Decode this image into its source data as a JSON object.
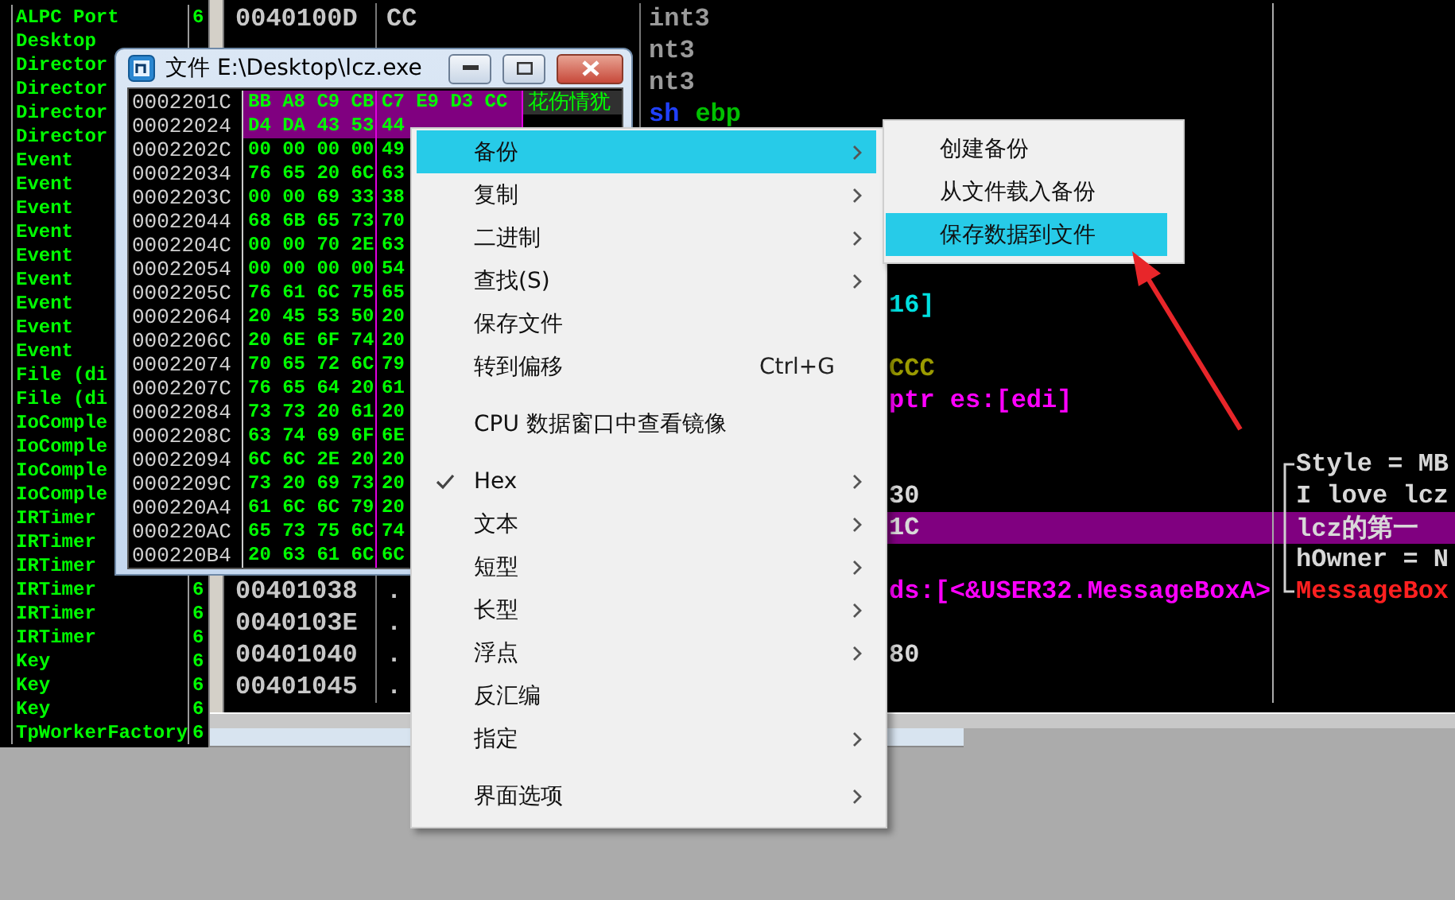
{
  "handles": {
    "rows": [
      {
        "type": "ALPC Port",
        "count": "6"
      },
      {
        "type": "Desktop"
      },
      {
        "type": "Director"
      },
      {
        "type": "Director"
      },
      {
        "type": "Director"
      },
      {
        "type": "Director"
      },
      {
        "type": "Event"
      },
      {
        "type": "Event"
      },
      {
        "type": "Event"
      },
      {
        "type": "Event"
      },
      {
        "type": "Event"
      },
      {
        "type": "Event"
      },
      {
        "type": "Event"
      },
      {
        "type": "Event"
      },
      {
        "type": "Event"
      },
      {
        "type": "File (di"
      },
      {
        "type": "File (di"
      },
      {
        "type": "IoComple"
      },
      {
        "type": "IoComple"
      },
      {
        "type": "IoComple"
      },
      {
        "type": "IoComple"
      },
      {
        "type": "IRTimer"
      },
      {
        "type": "IRTimer"
      },
      {
        "type": "IRTimer"
      },
      {
        "type": "IRTimer",
        "count": "6"
      },
      {
        "type": "IRTimer",
        "count": "6"
      },
      {
        "type": "IRTimer",
        "count": "6"
      },
      {
        "type": "Key",
        "count": "6"
      },
      {
        "type": "Key",
        "count": "6"
      },
      {
        "type": "Key",
        "count": "6"
      },
      {
        "type": "TpWorkerFactory",
        "count": "6"
      }
    ]
  },
  "disassembly": {
    "rows": [
      {
        "selected": false,
        "address": "0040100D",
        "bytes": "CC",
        "instruction": [
          {
            "text": "int3",
            "kind": "filler"
          }
        ]
      },
      {
        "selected": false,
        "instruction": [
          {
            "text": "nt3",
            "kind": "filler"
          }
        ]
      },
      {
        "selected": false,
        "instruction": [
          {
            "text": "nt3",
            "kind": "filler"
          }
        ]
      },
      {
        "selected": false,
        "instruction": [
          {
            "text": "sh",
            "kind": "keyword"
          },
          {
            "text": "ebp",
            "kind": "register"
          }
        ]
      },
      {
        "selected": false
      },
      {
        "selected": false
      },
      {
        "selected": false
      },
      {
        "selected": false
      },
      {
        "selected": false
      },
      {
        "selected": false,
        "instruction_tail": {
          "text": "16]",
          "kind": "memory"
        }
      },
      {
        "selected": false
      },
      {
        "selected": false,
        "instruction_tail": {
          "text": "CCC",
          "kind": "constant"
        }
      },
      {
        "selected": false,
        "instruction_tail": {
          "text": "ptr es:[edi]",
          "kind": "string"
        }
      },
      {
        "selected": false
      },
      {
        "selected": false,
        "comment": {
          "text": "Style = MB",
          "kind": "plain"
        }
      },
      {
        "selected": false,
        "instruction_tail": {
          "text": "30",
          "kind": "plain"
        },
        "comment": {
          "text": "I love lcz",
          "kind": "plain"
        }
      },
      {
        "selected": true,
        "instruction_tail": {
          "text": "1C",
          "kind": "plain"
        },
        "comment": {
          "text": "lcz的第一",
          "kind": "plain"
        }
      },
      {
        "selected": false,
        "comment": {
          "text": "hOwner = N",
          "kind": "plain"
        }
      },
      {
        "selected": false,
        "address": "00401038",
        "bytes": ".",
        "instruction_tail": {
          "text": "ds:[<&USER32.MessageBoxA>",
          "kind": "string"
        },
        "comment": {
          "text": "MessageBox",
          "kind": "call"
        }
      },
      {
        "selected": false,
        "address": "0040103E",
        "bytes": "."
      },
      {
        "selected": false,
        "address": "00401040",
        "bytes": ".",
        "instruction_tail": {
          "text": "80",
          "kind": "plain"
        }
      },
      {
        "selected": false,
        "address": "00401045",
        "bytes": "."
      }
    ]
  },
  "hex_window": {
    "title": "文件 E:\\Desktop\\lcz.exe",
    "rows": [
      {
        "address": "0002201C",
        "group_1": "BB A8 C9 CB",
        "group_2": "C7 E9 D3 CC",
        "ascii": "花伤情犹",
        "selected": true
      },
      {
        "address": "00022024",
        "group_1": "D4 DA 43 53",
        "group_2": "44",
        "selected": true
      },
      {
        "address": "0002202C",
        "group_1": "00 00 00 00",
        "group_2": "49",
        "selected": false
      },
      {
        "address": "00022034",
        "group_1": "76 65 20 6C",
        "group_2": "63",
        "selected": false
      },
      {
        "address": "0002203C",
        "group_1": "00 00 69 33",
        "group_2": "38",
        "selected": false
      },
      {
        "address": "00022044",
        "group_1": "68 6B 65 73",
        "group_2": "70",
        "selected": false
      },
      {
        "address": "0002204C",
        "group_1": "00 00 70 2E",
        "group_2": "63",
        "selected": false
      },
      {
        "address": "00022054",
        "group_1": "00 00 00 00",
        "group_2": "54",
        "selected": false
      },
      {
        "address": "0002205C",
        "group_1": "76 61 6C 75",
        "group_2": "65",
        "selected": false
      },
      {
        "address": "00022064",
        "group_1": "20 45 53 50",
        "group_2": "20",
        "selected": false
      },
      {
        "address": "0002206C",
        "group_1": "20 6E 6F 74",
        "group_2": "20",
        "selected": false
      },
      {
        "address": "00022074",
        "group_1": "70 65 72 6C",
        "group_2": "79",
        "selected": false
      },
      {
        "address": "0002207C",
        "group_1": "76 65 64 20",
        "group_2": "61",
        "selected": false
      },
      {
        "address": "00022084",
        "group_1": "73 73 20 61",
        "group_2": "20",
        "selected": false
      },
      {
        "address": "0002208C",
        "group_1": "63 74 69 6F",
        "group_2": "6E",
        "selected": false
      },
      {
        "address": "00022094",
        "group_1": "6C 6C 2E 20",
        "group_2": "20",
        "selected": false
      },
      {
        "address": "0002209C",
        "group_1": "73 20 69 73",
        "group_2": "20",
        "selected": false
      },
      {
        "address": "000220A4",
        "group_1": "61 6C 6C 79",
        "group_2": "20",
        "selected": false
      },
      {
        "address": "000220AC",
        "group_1": "65 73 75 6C",
        "group_2": "74",
        "selected": false
      },
      {
        "address": "000220B4",
        "group_1": "20 63 61 6C",
        "group_2": "6C",
        "selected": false
      }
    ]
  },
  "context_menu": {
    "groups": [
      [
        {
          "label": "备份",
          "submenu": true,
          "selected": true,
          "checked": false
        },
        {
          "label": "复制",
          "submenu": true,
          "selected": false,
          "checked": false
        },
        {
          "label": "二进制",
          "submenu": true,
          "selected": false,
          "checked": false
        },
        {
          "label": "查找(S)",
          "submenu": true,
          "selected": false,
          "checked": false
        },
        {
          "label": "保存文件",
          "submenu": false,
          "selected": false,
          "checked": false
        },
        {
          "label": "转到偏移",
          "shortcut": "Ctrl+G",
          "submenu": false,
          "selected": false,
          "checked": false
        }
      ],
      [
        {
          "label": "CPU 数据窗口中查看镜像",
          "submenu": false,
          "selected": false,
          "checked": false
        }
      ],
      [
        {
          "label": "Hex",
          "submenu": true,
          "selected": false,
          "checked": true
        },
        {
          "label": "文本",
          "submenu": true,
          "selected": false,
          "checked": false
        },
        {
          "label": "短型",
          "submenu": true,
          "selected": false,
          "checked": false
        },
        {
          "label": "长型",
          "submenu": true,
          "selected": false,
          "checked": false
        },
        {
          "label": "浮点",
          "submenu": true,
          "selected": false,
          "checked": false
        },
        {
          "label": "反汇编",
          "submenu": false,
          "selected": false,
          "checked": false
        },
        {
          "label": "指定",
          "submenu": true,
          "selected": false,
          "checked": false
        }
      ],
      [
        {
          "label": "界面选项",
          "submenu": true,
          "selected": false,
          "checked": false
        }
      ]
    ]
  },
  "submenu": {
    "items": [
      {
        "label": "创建备份",
        "selected": false
      },
      {
        "label": "从文件载入备份",
        "selected": false
      },
      {
        "label": "保存数据到文件",
        "selected": true
      }
    ]
  }
}
